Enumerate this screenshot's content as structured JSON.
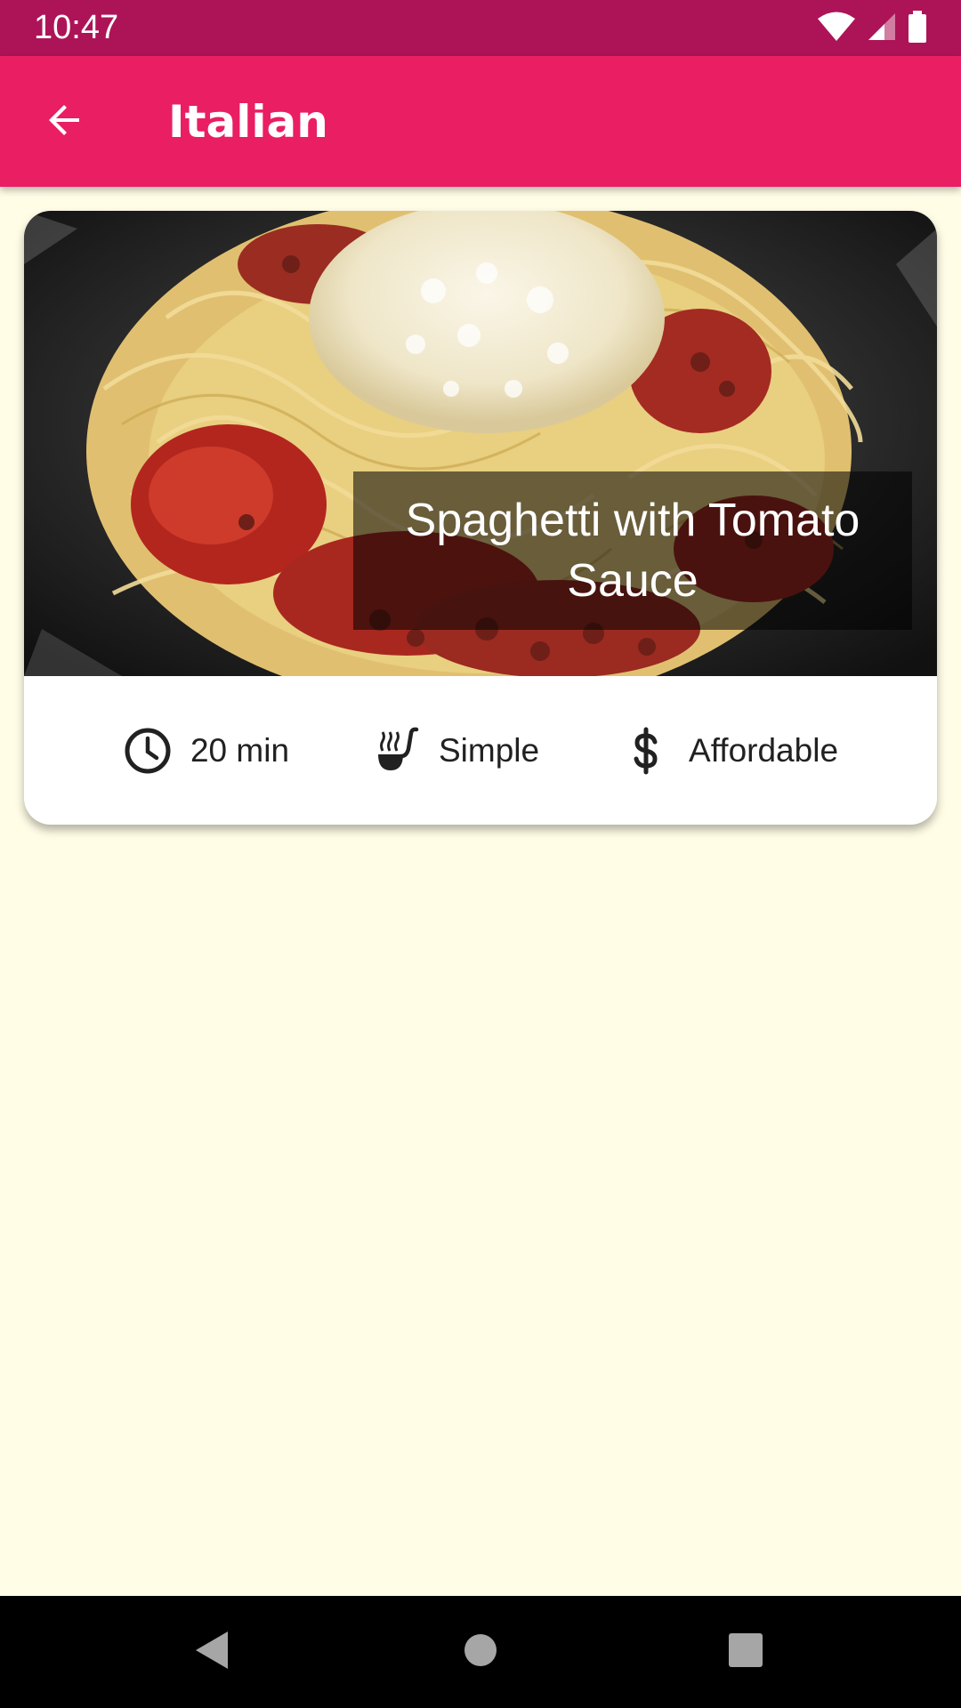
{
  "status_bar": {
    "time": "10:47",
    "icons": [
      "wifi-icon",
      "cellular-signal-icon",
      "battery-icon"
    ]
  },
  "app_bar": {
    "title": "Italian",
    "back_icon": "arrow-back-icon"
  },
  "meals": [
    {
      "title": "Spaghetti with Tomato Sauce",
      "duration": "20 min",
      "complexity": "Simple",
      "affordability": "Affordable",
      "icons": {
        "duration": "clock-icon",
        "complexity": "ladle-icon",
        "affordability": "dollar-icon"
      }
    }
  ],
  "nav_bar": {
    "buttons": [
      "back-triangle-icon",
      "home-circle-icon",
      "recents-square-icon"
    ]
  },
  "colors": {
    "status_bar": "#AD1457",
    "app_bar": "#E91E63",
    "background": "#FFFDE6",
    "card": "#FFFFFF",
    "nav_bar": "#000000"
  }
}
